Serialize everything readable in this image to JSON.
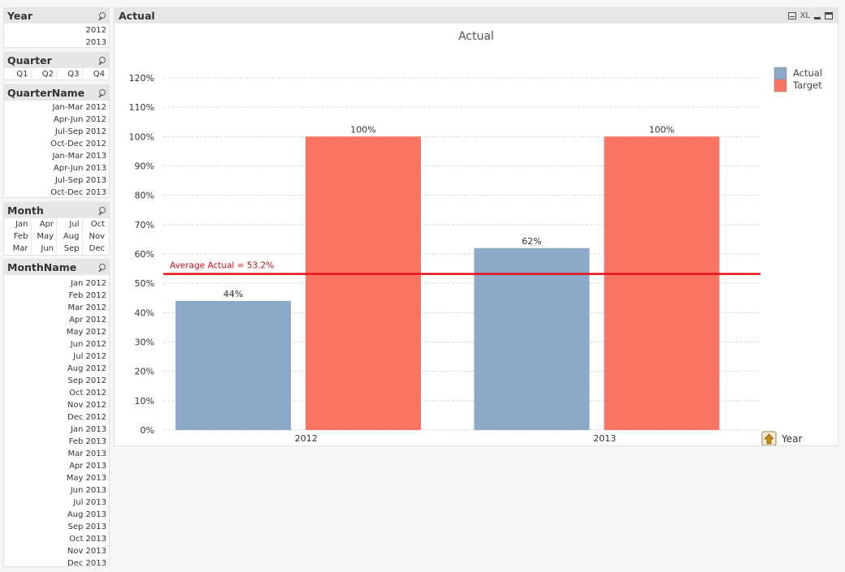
{
  "listboxes": {
    "year": {
      "title": "Year",
      "items": [
        "2012",
        "2013"
      ]
    },
    "quarter": {
      "title": "Quarter",
      "items": [
        "Q1",
        "Q2",
        "Q3",
        "Q4"
      ]
    },
    "quartername": {
      "title": "QuarterName",
      "items": [
        "Jan-Mar 2012",
        "Apr-Jun 2012",
        "Jul-Sep 2012",
        "Oct-Dec 2012",
        "Jan-Mar 2013",
        "Apr-Jun 2013",
        "Jul-Sep 2013",
        "Oct-Dec 2013"
      ]
    },
    "month": {
      "title": "Month",
      "columns": [
        [
          "Jan",
          "Feb",
          "Mar"
        ],
        [
          "Apr",
          "May",
          "Jun"
        ],
        [
          "Jul",
          "Aug",
          "Sep"
        ],
        [
          "Oct",
          "Nov",
          "Dec"
        ]
      ]
    },
    "monthname": {
      "title": "MonthName",
      "items": [
        "Jan 2012",
        "Feb 2012",
        "Mar 2012",
        "Apr 2012",
        "May 2012",
        "Jun 2012",
        "Jul 2012",
        "Aug 2012",
        "Sep 2012",
        "Oct 2012",
        "Nov 2012",
        "Dec 2012",
        "Jan 2013",
        "Feb 2013",
        "Mar 2013",
        "Apr 2013",
        "May 2013",
        "Jun 2013",
        "Jul 2013",
        "Aug 2013",
        "Sep 2013",
        "Oct 2013",
        "Nov 2013",
        "Dec 2013"
      ]
    }
  },
  "chart_object": {
    "caption": "Actual",
    "header_icons": {
      "print": "print-icon",
      "xl_label": "XL",
      "minimize": "minimize-icon",
      "maximize": "maximize-icon"
    },
    "dimension_label": "Year",
    "dimension_icon": "drill-up-arrow-icon"
  },
  "chart_data": {
    "type": "bar",
    "title": "Actual",
    "categories": [
      "2012",
      "2013"
    ],
    "series": [
      {
        "name": "Actual",
        "values": [
          44,
          62
        ],
        "labels": [
          "44%",
          "62%"
        ],
        "color": "#8da9c8"
      },
      {
        "name": "Target",
        "values": [
          100,
          100
        ],
        "labels": [
          "100%",
          "100%"
        ],
        "color": "#fa7464"
      }
    ],
    "yticks": [
      "0%",
      "10%",
      "20%",
      "30%",
      "40%",
      "50%",
      "60%",
      "70%",
      "80%",
      "90%",
      "100%",
      "110%",
      "120%"
    ],
    "ylim": [
      0,
      120
    ],
    "xlabel": "Year",
    "ylabel": "",
    "grid": true,
    "legend": "top-right",
    "reference_line": {
      "label": "Average Actual = 53.2%",
      "value": 53.2,
      "color": "#e8101a"
    }
  }
}
